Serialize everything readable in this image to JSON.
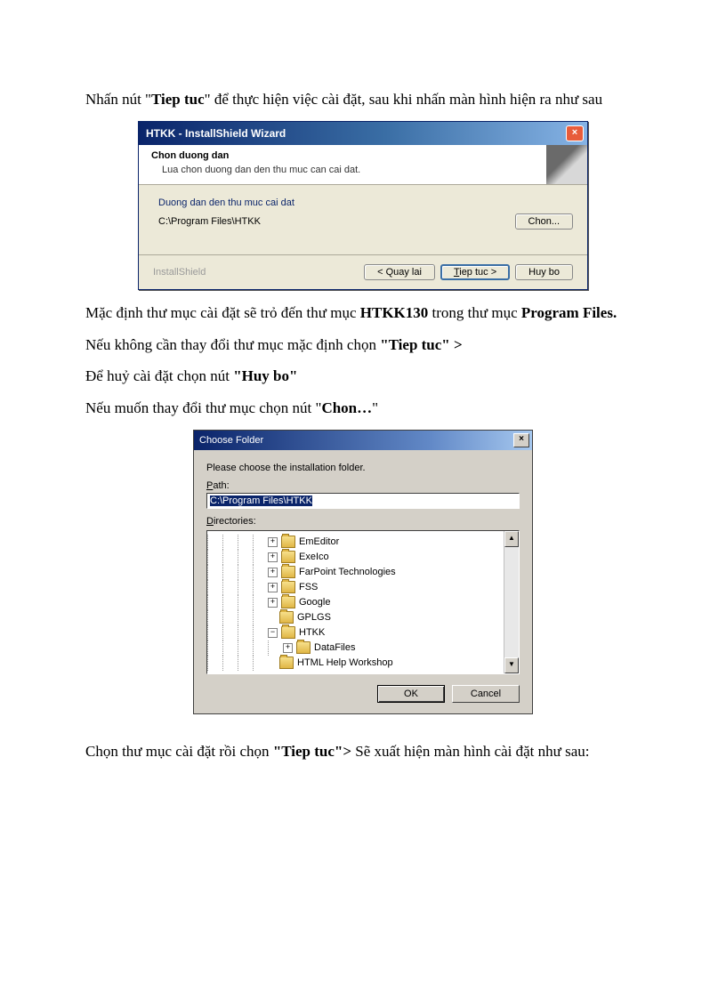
{
  "text": {
    "p1_a": "Nhấn nút \"",
    "p1_b": "Tiep tuc",
    "p1_c": "\" để thực hiện việc cài đặt, sau khi nhấn màn hình hiện ra như sau",
    "p2_a": "Mặc định thư mục cài đặt sẽ trỏ đến thư mục ",
    "p2_b": "HTKK130",
    "p2_c": " trong thư mục ",
    "p2_d": "Program Files.",
    "p3_a": "Nếu không cần thay đổi thư mục mặc định chọn ",
    "p3_b": "\"Tiep tuc\" >",
    "p4_a": "Để huỷ cài đặt chọn nút ",
    "p4_b": "\"Huy bo\"",
    "p5_a": "Nếu muốn thay đổi thư mục chọn nút \"",
    "p5_b": "Chon…",
    "p5_c": "\"",
    "p6_a": "Chọn thư mục cài đặt rồi chọn ",
    "p6_b": "\"Tiep tuc\">",
    "p6_c": " Sẽ xuất hiện màn hình cài đặt như sau:"
  },
  "dlg1": {
    "title": "HTKK - InstallShield Wizard",
    "header_title": "Chon duong dan",
    "header_sub": "Lua chon duong dan den thu muc can cai dat.",
    "frame_label": "Duong dan den thu muc cai dat",
    "path": "C:\\Program Files\\HTKK",
    "btn_chon": "Chon...",
    "brand": "InstallShield",
    "btn_back": "< Quay lai",
    "btn_next_prefix": "T",
    "btn_next_rest": "iep tuc >",
    "btn_cancel": "Huy bo"
  },
  "dlg2": {
    "title": "Choose Folder",
    "instruction": "Please choose the installation folder.",
    "path_label_prefix": "P",
    "path_label_rest": "ath:",
    "path_value": "C:\\Program Files\\HTKK",
    "dir_label_prefix": "D",
    "dir_label_rest": "irectories:",
    "tree": [
      {
        "indent": 4,
        "sign": "+",
        "label": "EmEditor"
      },
      {
        "indent": 4,
        "sign": "+",
        "label": "ExeIco"
      },
      {
        "indent": 4,
        "sign": "+",
        "label": "FarPoint Technologies"
      },
      {
        "indent": 4,
        "sign": "+",
        "label": "FSS"
      },
      {
        "indent": 4,
        "sign": "+",
        "label": "Google"
      },
      {
        "indent": 4,
        "sign": "",
        "label": "GPLGS"
      },
      {
        "indent": 4,
        "sign": "−",
        "label": "HTKK"
      },
      {
        "indent": 5,
        "sign": "+",
        "label": "DataFiles"
      },
      {
        "indent": 4,
        "sign": "",
        "label": "HTML Help Workshop"
      }
    ],
    "btn_ok": "OK",
    "btn_cancel": "Cancel"
  }
}
